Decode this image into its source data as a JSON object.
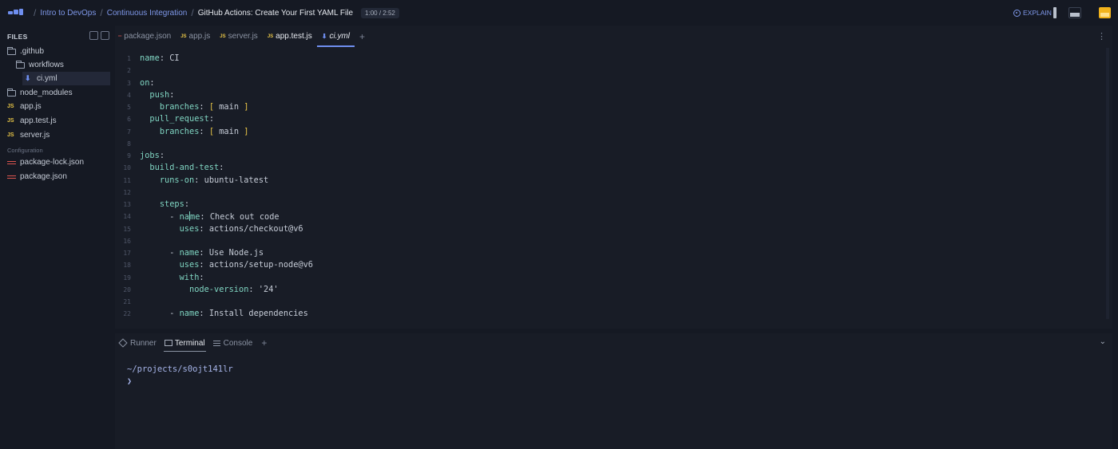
{
  "topbar": {
    "breadcrumbs": [
      "Intro to DevOps",
      "Continuous Integration"
    ],
    "current": "GitHub Actions: Create Your First YAML File",
    "timer": "1:00 / 2:52",
    "explain_label": "EXPLAIN",
    "accent": "#6f8ff0"
  },
  "sidebar": {
    "title": "FILES",
    "section_label": "Configuration",
    "items": [
      {
        "label": ".github",
        "icon": "folder-icon"
      },
      {
        "label": "workflows",
        "icon": "folder-icon"
      },
      {
        "label": "ci.yml",
        "icon": "yaml-icon"
      },
      {
        "label": "node_modules",
        "icon": "folder-icon"
      },
      {
        "label": "app.js",
        "icon": "js-icon"
      },
      {
        "label": "app.test.js",
        "icon": "js-icon"
      },
      {
        "label": "server.js",
        "icon": "js-icon"
      },
      {
        "label": "package-lock.json",
        "icon": "json-icon"
      },
      {
        "label": "package.json",
        "icon": "json-icon"
      }
    ]
  },
  "editor": {
    "tabs": [
      {
        "label": "package.json",
        "icon": "json-icon"
      },
      {
        "label": "app.js",
        "icon": "js-icon"
      },
      {
        "label": "server.js",
        "icon": "js-icon"
      },
      {
        "label": "app.test.js",
        "icon": "js-icon"
      },
      {
        "label": "ci.yml",
        "icon": "yaml-icon"
      }
    ],
    "active_tab": "ci.yml",
    "lines": [
      {
        "n": "1",
        "indent": "",
        "key": "name",
        "value": " CI",
        "bracket": false
      },
      {
        "n": "2",
        "indent": "",
        "key": "",
        "value": "",
        "bracket": false
      },
      {
        "n": "3",
        "indent": "",
        "key": "on",
        "value": "",
        "bracket": false
      },
      {
        "n": "4",
        "indent": "  ",
        "key": "push",
        "value": "",
        "bracket": false
      },
      {
        "n": "5",
        "indent": "    ",
        "key": "branches",
        "value": "main",
        "bracket": true
      },
      {
        "n": "6",
        "indent": "  ",
        "key": "pull_request",
        "value": "",
        "bracket": false
      },
      {
        "n": "7",
        "indent": "    ",
        "key": "branches",
        "value": "main",
        "bracket": true
      },
      {
        "n": "8",
        "indent": "",
        "key": "",
        "value": "",
        "bracket": false
      },
      {
        "n": "9",
        "indent": "",
        "key": "jobs",
        "value": "",
        "bracket": false
      },
      {
        "n": "10",
        "indent": "  ",
        "key": "build-and-test",
        "value": "",
        "bracket": false
      },
      {
        "n": "11",
        "indent": "    ",
        "key": "runs-on",
        "value": " ubuntu-latest",
        "bracket": false
      },
      {
        "n": "12",
        "indent": "",
        "key": "",
        "value": "",
        "bracket": false
      },
      {
        "n": "13",
        "indent": "    ",
        "key": "steps",
        "value": "",
        "bracket": false
      },
      {
        "n": "14",
        "indent": "      - ",
        "key": "name",
        "value": " Check out code",
        "bracket": false
      },
      {
        "n": "15",
        "indent": "        ",
        "key": "uses",
        "value": " actions/checkout@v6",
        "bracket": false
      },
      {
        "n": "16",
        "indent": "",
        "key": "",
        "value": "",
        "bracket": false
      },
      {
        "n": "17",
        "indent": "      - ",
        "key": "name",
        "value": " Use Node.js",
        "bracket": false
      },
      {
        "n": "18",
        "indent": "        ",
        "key": "uses",
        "value": " actions/setup-node@v6",
        "bracket": false
      },
      {
        "n": "19",
        "indent": "        ",
        "key": "with",
        "value": "",
        "bracket": false
      },
      {
        "n": "20",
        "indent": "          ",
        "key": "node-version",
        "value": " '24'",
        "bracket": false
      },
      {
        "n": "21",
        "indent": "",
        "key": "",
        "value": "",
        "bracket": false
      },
      {
        "n": "22",
        "indent": "      - ",
        "key": "name",
        "value": " Install dependencies",
        "bracket": false
      }
    ]
  },
  "panel": {
    "tabs": [
      "Runner",
      "Terminal",
      "Console"
    ],
    "active_tab": "Terminal",
    "terminal_path": "~/projects/s0ojt141lr",
    "prompt": "❯"
  }
}
